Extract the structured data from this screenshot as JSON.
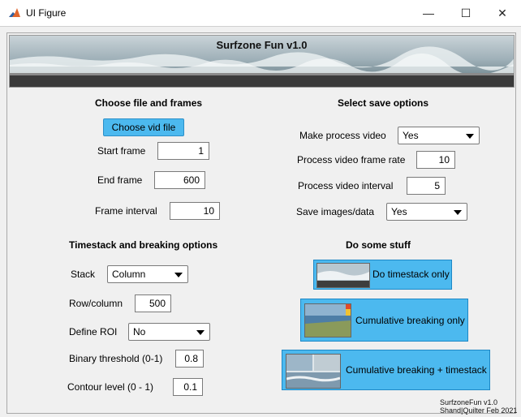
{
  "window": {
    "title": "UI Figure",
    "controls": {
      "minimize": "—",
      "maximize": "☐",
      "close": "✕"
    }
  },
  "banner": {
    "title": "Surfzone Fun v1.0"
  },
  "file_section": {
    "heading": "Choose file and frames",
    "choose_button": "Choose vid file",
    "start_frame_label": "Start frame",
    "start_frame_value": "1",
    "end_frame_label": "End frame",
    "end_frame_value": "600",
    "frame_interval_label": "Frame interval",
    "frame_interval_value": "10"
  },
  "save_section": {
    "heading": "Select save options",
    "make_video_label": "Make process video",
    "make_video_value": "Yes",
    "frame_rate_label": "Process video frame rate",
    "frame_rate_value": "10",
    "interval_label": "Process video interval",
    "interval_value": "5",
    "save_images_label": "Save images/data",
    "save_images_value": "Yes"
  },
  "timestack_section": {
    "heading": "Timestack and breaking options",
    "stack_label": "Stack",
    "stack_value": "Column",
    "rowcol_label": "Row/column",
    "rowcol_value": "500",
    "roi_label": "Define ROI",
    "roi_value": "No",
    "binary_label": "Binary threshold (0-1)",
    "binary_value": "0.8",
    "contour_label": "Contour level (0 - 1)",
    "contour_value": "0.1"
  },
  "actions_section": {
    "heading": "Do some stuff",
    "timestack_button": "Do timestack only",
    "cumulative_button": "Cumulative breaking only",
    "both_button": "Cumulative breaking + timestack"
  },
  "footer": {
    "line1": "SurfzoneFun v1.0",
    "line2": "Shand|Quilter Feb 2021"
  },
  "colors": {
    "button_blue": "#4cb9ef",
    "panel_bg": "#f0f0f0"
  },
  "icons": {
    "app": "matlab-logo-icon",
    "minimize": "minimize-icon",
    "maximize": "maximize-icon",
    "close": "close-icon"
  }
}
